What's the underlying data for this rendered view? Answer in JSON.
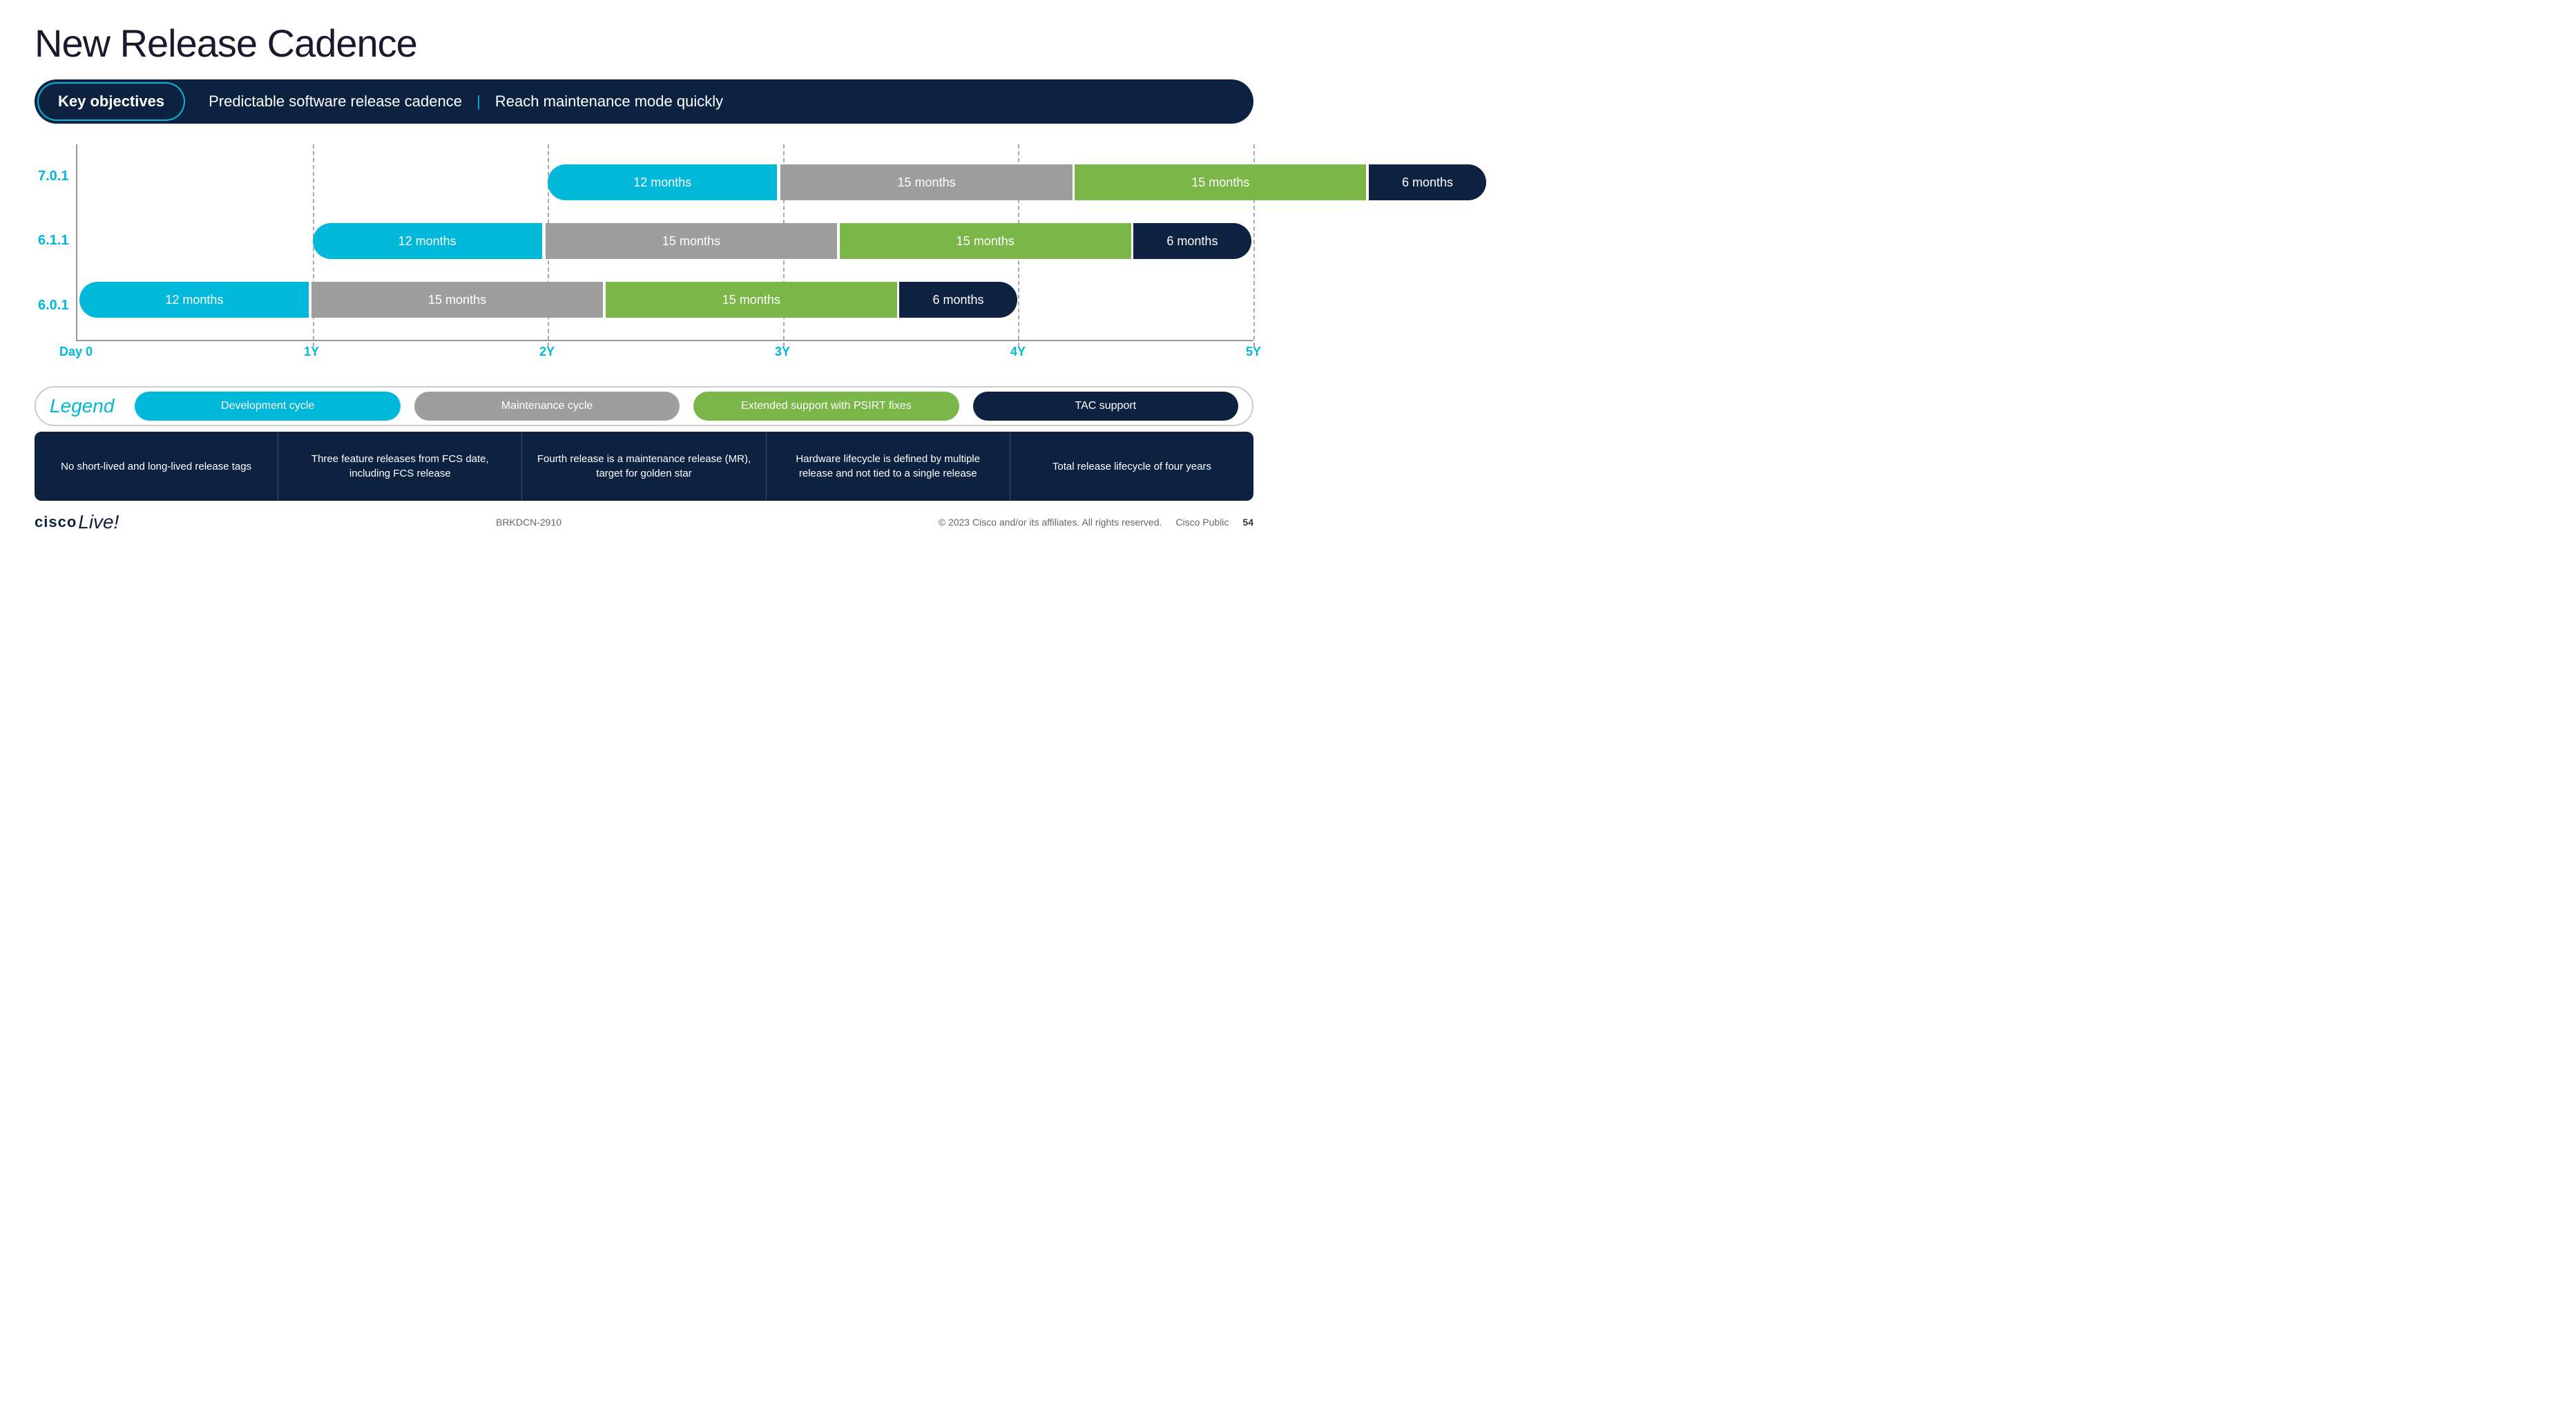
{
  "title": "New Release Cadence",
  "objectives": {
    "label": "Key objectives",
    "text1": "Predictable software release cadence",
    "divider": "|",
    "text2": "Reach maintenance mode quickly"
  },
  "chart": {
    "y_labels": [
      "7.0.1",
      "6.1.1",
      "6.0.1"
    ],
    "x_labels": [
      "Day 0",
      "1Y",
      "2Y",
      "3Y",
      "4Y",
      "5Y"
    ],
    "rows": {
      "row_7_0_1": {
        "segments": [
          {
            "label": "12 months",
            "type": "cyan"
          },
          {
            "label": "15 months",
            "type": "gray"
          },
          {
            "label": "15 months",
            "type": "green"
          },
          {
            "label": "6 months",
            "type": "dark"
          }
        ]
      },
      "row_6_1_1": {
        "segments": [
          {
            "label": "12 months",
            "type": "cyan"
          },
          {
            "label": "15 months",
            "type": "gray"
          },
          {
            "label": "15 months",
            "type": "green"
          },
          {
            "label": "6 months",
            "type": "dark"
          }
        ]
      },
      "row_6_0_1": {
        "segments": [
          {
            "label": "12 months",
            "type": "cyan"
          },
          {
            "label": "15 months",
            "type": "gray"
          },
          {
            "label": "15 months",
            "type": "green"
          },
          {
            "label": "6 months",
            "type": "dark"
          }
        ]
      }
    }
  },
  "legend": {
    "title": "Legend",
    "items": [
      {
        "label": "Development cycle",
        "type": "cyan"
      },
      {
        "label": "Maintenance cycle",
        "type": "gray"
      },
      {
        "label": "Extended support with PSIRT fixes",
        "type": "green"
      },
      {
        "label": "TAC support",
        "type": "dark"
      }
    ]
  },
  "info_items": [
    "No short-lived and long-lived release tags",
    "Three feature releases from FCS date, including FCS release",
    "Fourth release is a maintenance release (MR), target for golden star",
    "Hardware lifecycle is defined by multiple release and not tied to a single release",
    "Total release lifecycle of four years"
  ],
  "footer": {
    "logo_cisco": "cisco",
    "logo_live": "Live!",
    "session_id": "BRKDCN-2910",
    "copyright": "© 2023  Cisco and/or its affiliates. All rights reserved.",
    "audience": "Cisco Public",
    "page_number": "54"
  }
}
